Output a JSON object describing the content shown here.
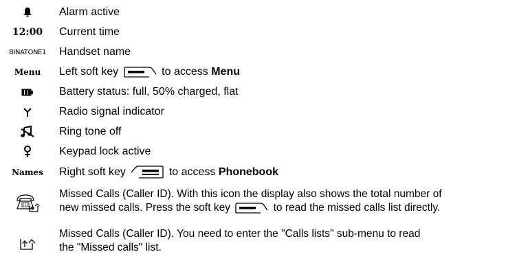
{
  "rows": [
    {
      "icon": "bell-icon",
      "text": "Alarm active"
    },
    {
      "icon_label": "12:00",
      "text": "Current time"
    },
    {
      "icon_label": "BINATONE1",
      "text": "Handset name"
    },
    {
      "icon_label": "Menu",
      "text_before": "Left soft key",
      "text_mid": "to access",
      "text_bold": "Menu"
    },
    {
      "icon": "battery-icon",
      "text": "Battery status: full, 50% charged, flat"
    },
    {
      "icon": "antenna-icon",
      "text": "Radio signal indicator"
    },
    {
      "icon": "ringtone-off-icon",
      "text": "Ring tone off"
    },
    {
      "icon": "keypad-lock-icon",
      "text": "Keypad lock active"
    },
    {
      "icon_label": "Names",
      "text_before": "Right soft key",
      "text_mid": "to access",
      "text_bold": "Phonebook"
    },
    {
      "icon": "missed-calls-phone-icon",
      "text_line1": "Missed Calls (Caller ID). With this icon the display also shows the total number of",
      "text_line2_before": "new missed calls. Press the soft key",
      "text_line2_after": "to read the missed calls list directly."
    },
    {
      "icon": "missed-calls-arrow-icon",
      "text_line1": "Missed Calls (Caller ID). You need to enter the \"Calls lists\" sub-menu to read",
      "text_line2": "the \"Missed calls\" list."
    }
  ]
}
